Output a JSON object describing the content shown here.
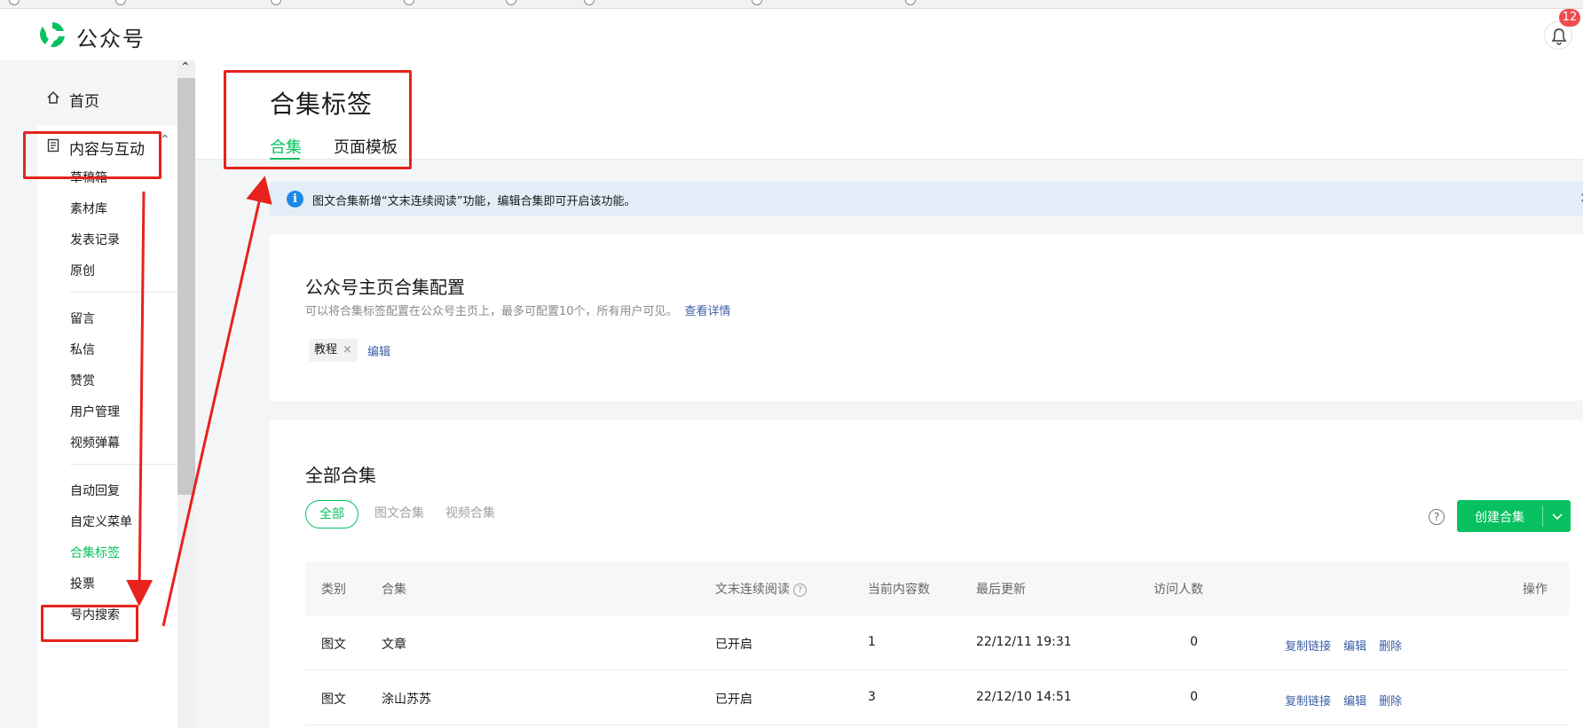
{
  "app": {
    "brand": "公众号",
    "notification_count": "12"
  },
  "sidebar": {
    "home": "首页",
    "group": "内容与互动",
    "items_a": [
      "草稿箱",
      "素材库",
      "发表记录",
      "原创"
    ],
    "items_b": [
      "留言",
      "私信",
      "赞赏",
      "用户管理",
      "视频弹幕"
    ],
    "items_c": [
      "自动回复",
      "自定义菜单",
      "合集标签",
      "投票",
      "号内搜索"
    ]
  },
  "page": {
    "title": "合集标签",
    "tabs": [
      "合集",
      "页面模板"
    ]
  },
  "notice": {
    "text": "图文合集新增“文末连续阅读”功能，编辑合集即可开启该功能。",
    "close": "×"
  },
  "homepage_config": {
    "title": "公众号主页合集配置",
    "description": "可以将合集标签配置在公众号主页上，最多可配置10个，所有用户可见。",
    "details_link": "查看详情",
    "tag": "教程",
    "tag_remove": "×",
    "edit": "编辑"
  },
  "all_collections": {
    "title": "全部合集",
    "filters": [
      "全部",
      "图文合集",
      "视频合集"
    ],
    "help": "?",
    "create_button": "创建合集",
    "columns": [
      "类别",
      "合集",
      "文末连续阅读",
      "当前内容数",
      "最后更新",
      "访问人数",
      "操作"
    ],
    "rows": [
      {
        "type": "图文",
        "name": "文章",
        "continuous": "已开启",
        "count": "1",
        "updated": "22/12/11 19:31",
        "visitors": "0"
      },
      {
        "type": "图文",
        "name": "涂山苏苏",
        "continuous": "已开启",
        "count": "3",
        "updated": "22/12/10 14:51",
        "visitors": "0"
      }
    ],
    "actions": [
      "复制链接",
      "编辑",
      "删除"
    ]
  },
  "colors": {
    "accent": "#07c160",
    "link": "#3a5ea8",
    "annotation": "#e8221c",
    "notice_bg": "#e3edf7",
    "info_icon": "#1e87e6"
  }
}
